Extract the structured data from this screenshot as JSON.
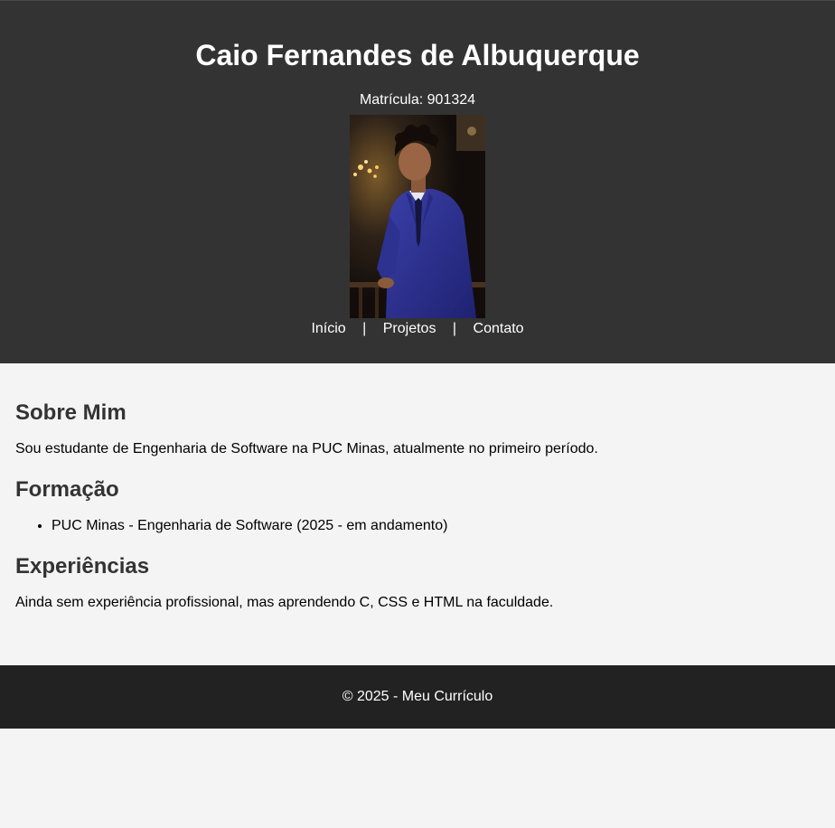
{
  "header": {
    "name": "Caio Fernandes de Albuquerque",
    "matricula": "Matrícula: 901324",
    "nav": [
      {
        "label": "Início"
      },
      {
        "label": "Projetos"
      },
      {
        "label": "Contato"
      }
    ],
    "nav_separator": "|"
  },
  "sections": {
    "sobre": {
      "title": "Sobre Mim",
      "text": "Sou estudante de Engenharia de Software na PUC Minas, atualmente no primeiro período."
    },
    "formacao": {
      "title": "Formação",
      "items": [
        "PUC Minas - Engenharia de Software (2025 - em andamento)"
      ]
    },
    "experiencias": {
      "title": "Experiências",
      "text": "Ainda sem experiência profissional, mas aprendendo C, CSS e HTML na faculdade."
    }
  },
  "footer": {
    "text": "© 2025 - Meu Currículo"
  },
  "colors": {
    "header_bg": "#333333",
    "footer_bg": "#222222",
    "page_bg": "#f4f4f4",
    "suit": "#2b2f8a"
  }
}
